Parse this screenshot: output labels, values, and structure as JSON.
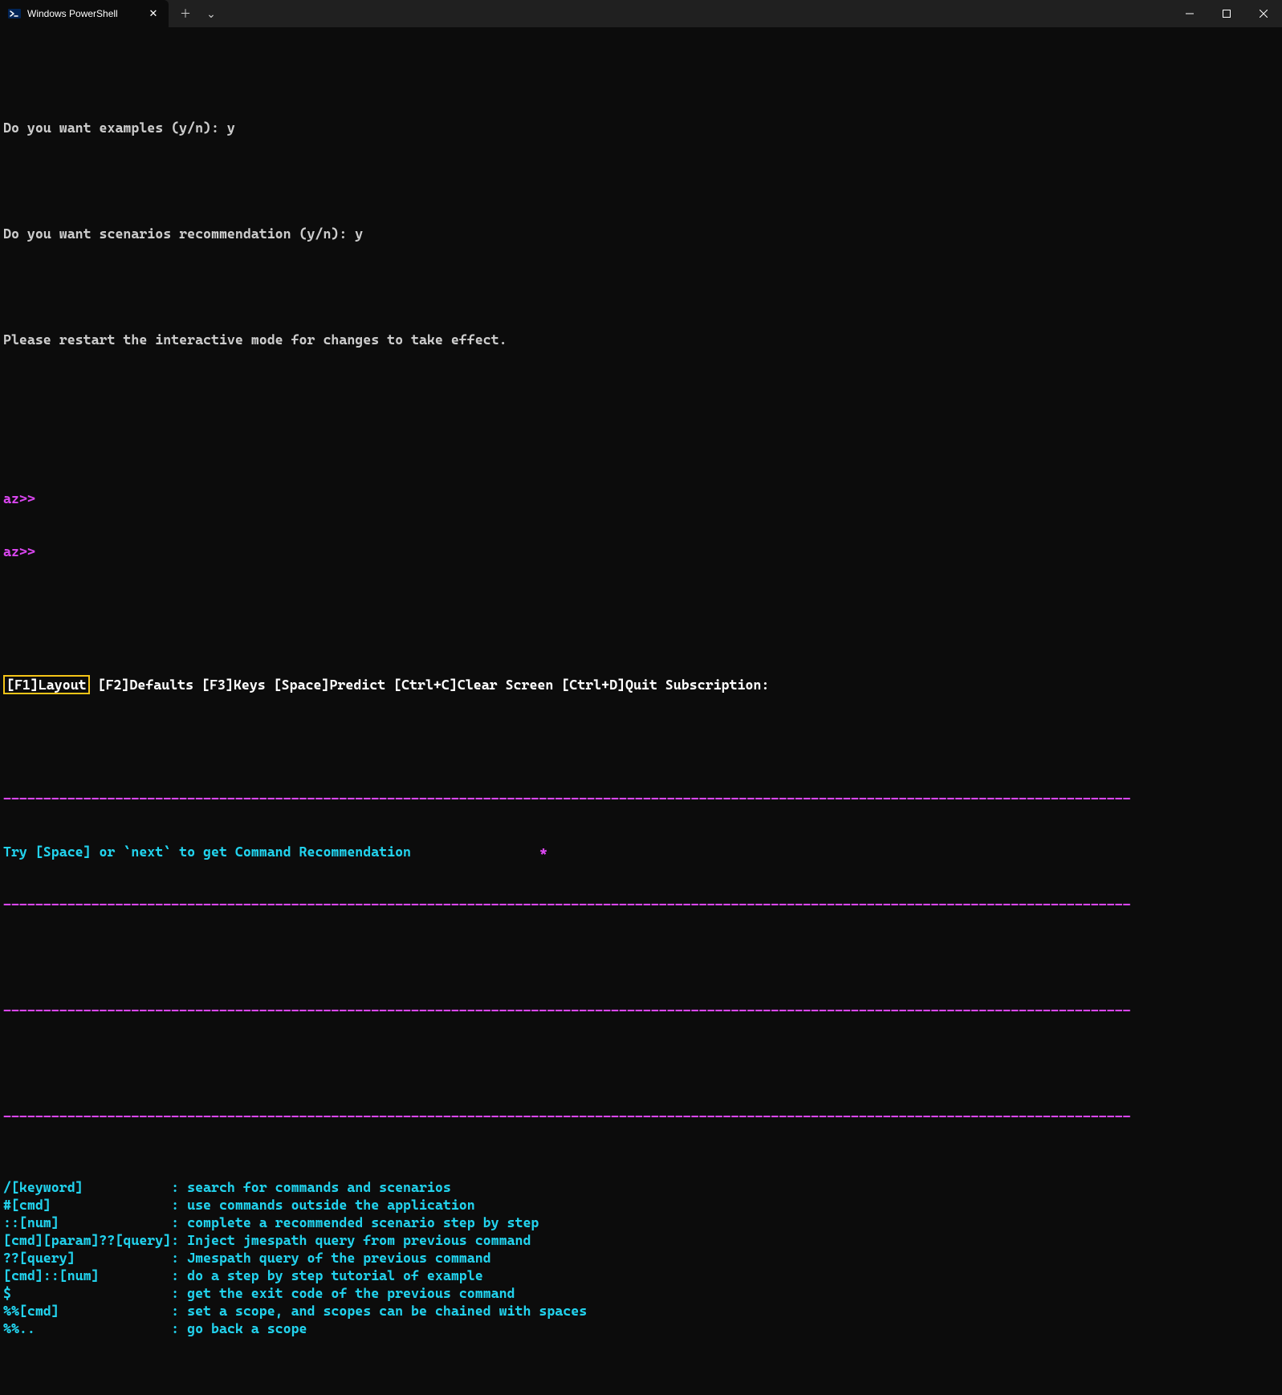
{
  "titlebar": {
    "tab_title": "Windows PowerShell",
    "close_glyph": "✕",
    "newtab_glyph": "＋",
    "dropdown_glyph": "⌄",
    "minimize_glyph": "—",
    "maximize_glyph": "▢",
    "winclose_glyph": "✕"
  },
  "terminal": {
    "line1": "Do you want examples (y/n): y",
    "line2": "Do you want scenarios recommendation (y/n): y",
    "line3": "Please restart the interactive mode for changes to take effect.",
    "prompt1": "az>>",
    "prompt2": "az>>",
    "dash_line": "---------------------------------------------------------------------------------------------------------------------------------------------",
    "recommend_text": "Try [Space] or `next` to get Command Recommendation",
    "recommend_star": "*"
  },
  "help": {
    "rows": [
      {
        "key": "/[keyword]",
        "desc": ": search for commands and scenarios"
      },
      {
        "key": "#[cmd]",
        "desc": ": use commands outside the application"
      },
      {
        "key": "::[num]",
        "desc": ": complete a recommended scenario step by step"
      },
      {
        "key": "[cmd][param]??[query]",
        "desc": ": Inject jmespath query from previous command"
      },
      {
        "key": "??[query]",
        "desc": ": Jmespath query of the previous command"
      },
      {
        "key": "[cmd]::[num]",
        "desc": ": do a step by step tutorial of example"
      },
      {
        "key": "$",
        "desc": ": get the exit code of the previous command"
      },
      {
        "key": "%%[cmd]",
        "desc": ": set a scope, and scopes can be chained with spaces"
      },
      {
        "key": "%%..",
        "desc": ": go back a scope"
      }
    ]
  },
  "statusbar": {
    "f1": "[F1]Layout",
    "rest": " [F2]Defaults [F3]Keys [Space]Predict [Ctrl+C]Clear Screen [Ctrl+D]Quit Subscription:"
  }
}
